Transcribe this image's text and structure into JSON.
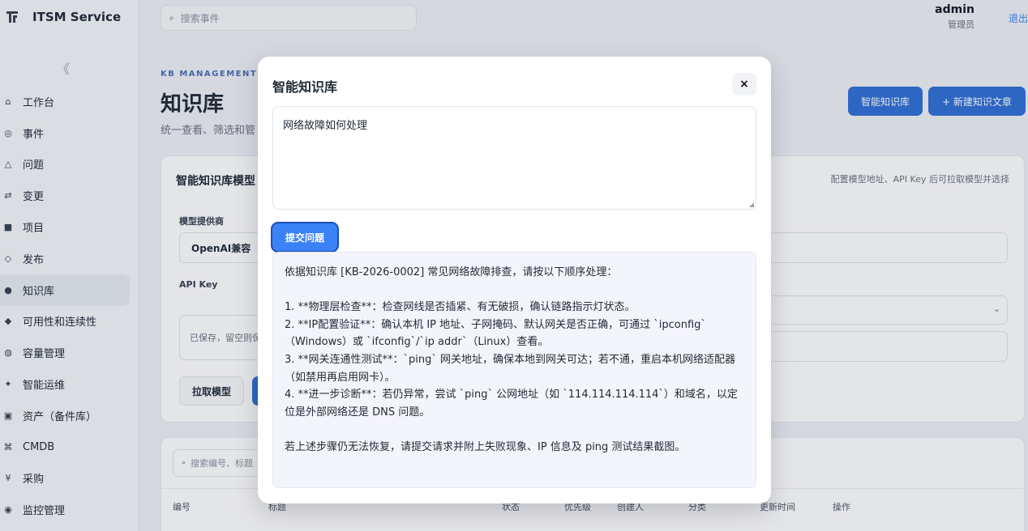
{
  "brand": {
    "name": "ITSM Service"
  },
  "sidebar": {
    "collapse_glyph": "《",
    "items": [
      {
        "icon": "⌂",
        "label": "工作台"
      },
      {
        "icon": "◎",
        "label": "事件"
      },
      {
        "icon": "△",
        "label": "问题"
      },
      {
        "icon": "⇄",
        "label": "变更"
      },
      {
        "icon": "■",
        "label": "项目"
      },
      {
        "icon": "◇",
        "label": "发布"
      },
      {
        "icon": "●",
        "label": "知识库"
      },
      {
        "icon": "◆",
        "label": "可用性和连续性"
      },
      {
        "icon": "◍",
        "label": "容量管理"
      },
      {
        "icon": "✦",
        "label": "智能运维"
      },
      {
        "icon": "▣",
        "label": "资产（备件库）"
      },
      {
        "icon": "⌘",
        "label": "CMDB"
      },
      {
        "icon": "¥",
        "label": "采购"
      },
      {
        "icon": "◉",
        "label": "监控管理"
      }
    ]
  },
  "topbar": {
    "search_placeholder": "搜索事件",
    "user_name": "admin",
    "user_role": "管理员",
    "logout": "退出"
  },
  "page": {
    "eyebrow": "KB MANAGEMENT",
    "title": "知识库",
    "subtitle": "统一查看、筛选和管",
    "btn_kb": "智能知识库",
    "btn_new": "+ 新建知识文章"
  },
  "model_card": {
    "title": "智能知识库模型",
    "hint": "配置模型地址、API Key 后可拉取模型并选择",
    "provider_label": "模型提供商",
    "provider_value": "OpenAI兼容",
    "key_label": "API Key",
    "key_placeholder": "已保存，留空则保",
    "pull_button": "拉取模型"
  },
  "list_card": {
    "search_placeholder": "搜索编号、标题",
    "columns": [
      "编号",
      "标题",
      "状态",
      "优先级",
      "创建人",
      "分类",
      "更新时间",
      "操作"
    ]
  },
  "modal": {
    "title": "智能知识库",
    "close": "×",
    "question": "网络故障如何处理",
    "submit": "提交问题",
    "answer": {
      "intro": "依据知识库 [KB-2026-0002] 常见网络故障排查，请按以下顺序处理：",
      "steps": [
        "1. **物理层检查**：检查网线是否插紧、有无破损，确认链路指示灯状态。",
        "2. **IP配置验证**：确认本机 IP 地址、子网掩码、默认网关是否正确，可通过 `ipconfig`（Windows）或 `ifconfig`/`ip addr`（Linux）查看。",
        "3. **网关连通性测试**：`ping` 网关地址，确保本地到网关可达；若不通，重启本机网络适配器（如禁用再启用网卡）。",
        "4. **进一步诊断**：若仍异常，尝试 `ping` 公网地址（如 `114.114.114.114`）和域名，以定位是外部网络还是 DNS 问题。"
      ],
      "outro": "若上述步骤仍无法恢复，请提交请求并附上失败现象、IP 信息及 ping 测试结果截图。"
    }
  }
}
